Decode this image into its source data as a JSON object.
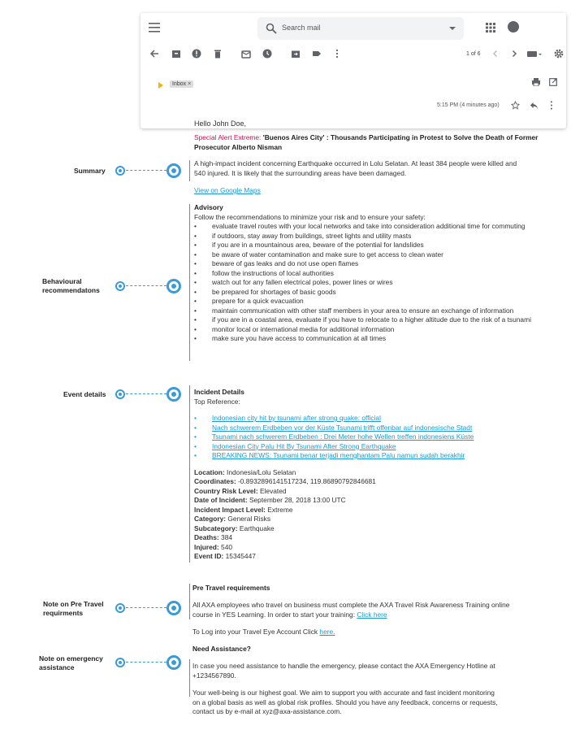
{
  "gmail": {
    "search_placeholder": "Search mail",
    "pager": "1 of 6",
    "inbox_chip": "Inbox ×",
    "time": "5:15 PM (4 minutes ago)",
    "icons": [
      "menu-icon",
      "search-icon",
      "apps-icon",
      "notifications-icon",
      "back-icon",
      "archive-icon",
      "spam-icon",
      "delete-icon",
      "mark-unread-icon",
      "snooze-icon",
      "move-icon",
      "label-icon",
      "more-icon",
      "prev-icon",
      "next-icon",
      "keyboard-icon",
      "settings-icon",
      "print-icon",
      "new-window-icon",
      "star-icon",
      "reply-icon"
    ]
  },
  "email": {
    "greeting": "Hello John Doe,",
    "alert_prefix": "Special Alert Extreme: ",
    "alert_title": "'Buenos Aires City' : Thousands Participating in Protest to Solve the Death of Former Prosecutor Alberto Nisman",
    "summary": "A high-impact incident concerning Earthquake occurred in Lolu Selatan. At least 384 people were killed and 540 injured. It is likely that the surrounding areas have been damaged.",
    "map_link": "View on Google Maps",
    "advisory_title": "Advisory",
    "advisory_intro": "Follow the recommendations to minimize your risk and to ensure your safety:",
    "advisory_items": [
      "evaluate travel routes with your local networks and take into consideration additional time for commuting",
      "if outdoors, stay away from buildings, street lights and utility masts",
      "if you are in a mountainous area, beware of the potential for landslides",
      "be aware of water contamination and make sure to get access to clean water",
      "beware of gas leaks and do not use open flames",
      "follow the instructions of local authorities",
      "watch out for any fallen electrical poles, power lines or wires",
      "be prepared for shortages of basic goods",
      "prepare for a quick evacuation",
      "maintain communication with other staff members in your area to ensure an exchange of information",
      "if you are in a coastal area, evaluate if you have to relocate to a higher altitude due to the risk of a tsunami",
      "monitor local or international media for additional information",
      "make sure you have access to communication at all times"
    ],
    "incident_title": "Incident Details",
    "top_reference": "Top Reference:",
    "references": [
      "Indonesian city hit by tsunami after strong quake: official",
      "Nach schwerem Erdbeben vor der Küste Tsunami trifft offenbar auf indonesische Stadt",
      "Tsunami nach schwerem Erdbeben : Drei Meter hohe Wellen treffen indonesiens Küste",
      "Indonesian City Palu Hit By Tsunami After Strong Earthquake",
      "BREAKING NEWS: Tsunami benar terjadi menghantam Palu namun sudah berakhir"
    ],
    "details": [
      {
        "label": "Location:",
        "value": "Indonesia/Lolu Selatan"
      },
      {
        "label": "Coordinates:",
        "value": "-0.8932896141517234, 119.86890792846681"
      },
      {
        "label": "Country Risk Level:",
        "value": "Elevated"
      },
      {
        "label": "Date of Incident:",
        "value": "September 28, 2018 13:00 UTC"
      },
      {
        "label": "Incident Impact Level:",
        "value": "Extreme"
      },
      {
        "label": "Category:",
        "value": "General Risks"
      },
      {
        "label": "Subcategory:",
        "value": "Earthquake"
      },
      {
        "label": "Deaths:",
        "value": "384"
      },
      {
        "label": "Injured:",
        "value": "540"
      },
      {
        "label": "Event ID:",
        "value": "15345447"
      }
    ],
    "pretravel_title": "Pre Travel requirements",
    "pretravel_text": "All AXA employees who travel on business must complete the AXA Travel Risk Awareness Training online course in YES Learning. In order to start your training: ",
    "pretravel_link": "Click here",
    "travel_eye_text": "To Log into your Travel Eye Account Click ",
    "travel_eye_link": "here.",
    "assistance_title": "Need Assistance?",
    "assistance_text": "In case you need assistance to handle the emergency, please contact the AXA Emergency Hotline at +1234567890.",
    "wellbeing_text": "Your well-being is our highest goal. We aim to support you with accurate and fast incident monitoring on a global basis as well as global risk profiles. Should you have any feedback, concerns or requests, contact us by e-mail at xyz@axa-assistance.com."
  },
  "annotations": {
    "summary": "Summary",
    "behavioural": "Behavioural recommendatons",
    "event": "Event details",
    "pretravel": "Note on Pre Travel requirments",
    "emergency": "Note on emergency assistance"
  },
  "accent_color": "#3b9bd9",
  "alert_color": "#d0104c"
}
